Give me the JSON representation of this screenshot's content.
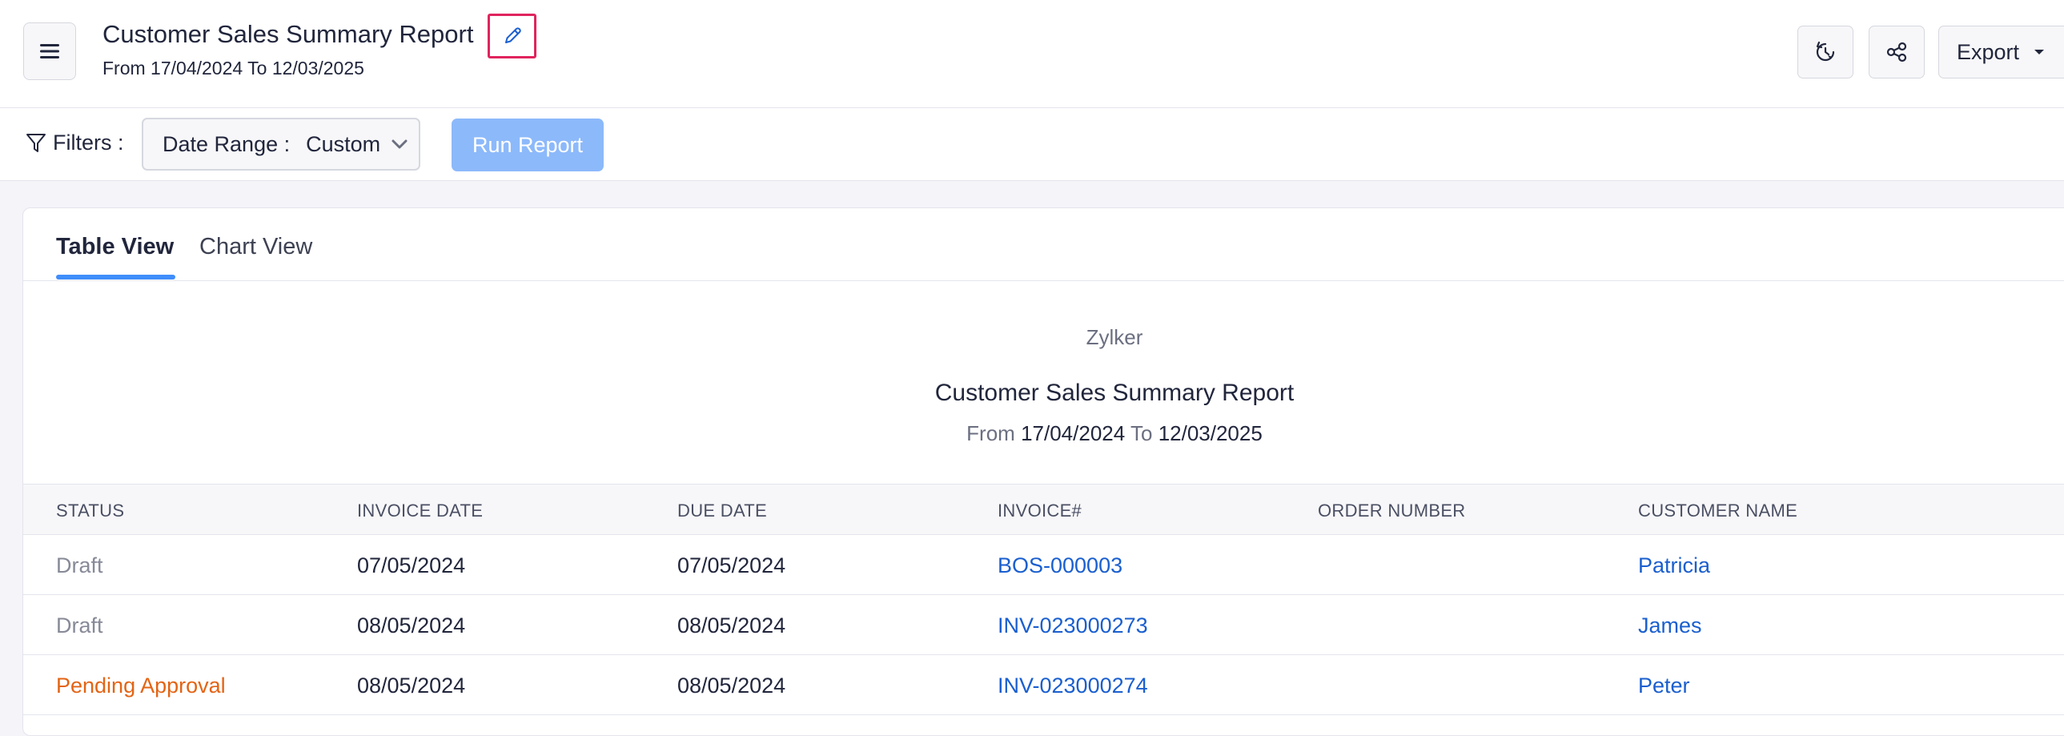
{
  "header": {
    "title": "Customer Sales Summary Report",
    "subtitle": "From 17/04/2024 To 12/03/2025",
    "export_label": "Export"
  },
  "filters": {
    "label": "Filters :",
    "date_range_label": "Date Range :",
    "date_range_value": "Custom",
    "run_button": "Run Report"
  },
  "tabs": [
    {
      "label": "Table View",
      "active": true
    },
    {
      "label": "Chart View",
      "active": false
    }
  ],
  "report": {
    "organization": "Zylker",
    "title": "Customer Sales Summary Report",
    "from_word": "From",
    "from_date": "17/04/2024",
    "to_word": "To",
    "to_date": "12/03/2025"
  },
  "table": {
    "columns": [
      "STATUS",
      "INVOICE DATE",
      "DUE DATE",
      "INVOICE#",
      "ORDER NUMBER",
      "CUSTOMER NAME"
    ],
    "rows": [
      {
        "status": "Draft",
        "invoice_date": "07/05/2024",
        "due_date": "07/05/2024",
        "invoice": "BOS-000003",
        "order_number": "",
        "customer": "Patricia"
      },
      {
        "status": "Draft",
        "invoice_date": "08/05/2024",
        "due_date": "08/05/2024",
        "invoice": "INV-023000273",
        "order_number": "",
        "customer": "James"
      },
      {
        "status": "Pending Approval",
        "invoice_date": "08/05/2024",
        "due_date": "08/05/2024",
        "invoice": "INV-023000274",
        "order_number": "",
        "customer": "Peter"
      }
    ]
  },
  "colors": {
    "accent": "#408dfb",
    "link": "#1a5fcf",
    "draft": "#878a97",
    "pending": "#e36414",
    "highlight": "#e0245e"
  }
}
